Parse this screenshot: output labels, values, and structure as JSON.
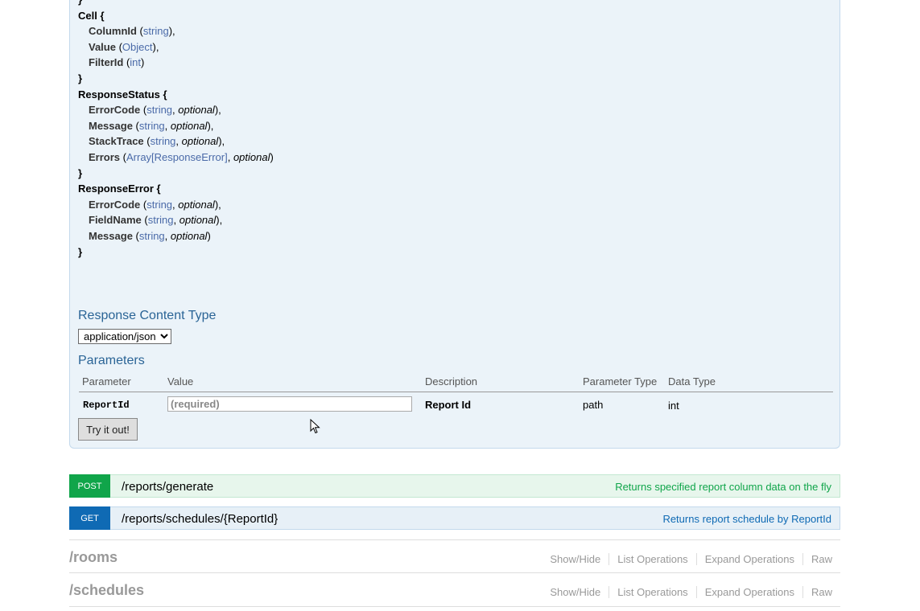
{
  "models": [
    {
      "id": "prev",
      "name": "",
      "closing_only": true,
      "props": []
    },
    {
      "id": "cell",
      "name": "Cell",
      "props": [
        {
          "name": "ColumnId",
          "type": "string",
          "optional": false,
          "trail": ","
        },
        {
          "name": "Value",
          "type": "Object",
          "optional": false,
          "trail": ","
        },
        {
          "name": "FilterId",
          "type": "int",
          "optional": false,
          "trail": ""
        }
      ]
    },
    {
      "id": "response-status",
      "name": "ResponseStatus",
      "props": [
        {
          "name": "ErrorCode",
          "type": "string",
          "optional": true,
          "trail": ","
        },
        {
          "name": "Message",
          "type": "string",
          "optional": true,
          "trail": ","
        },
        {
          "name": "StackTrace",
          "type": "string",
          "optional": true,
          "trail": ","
        },
        {
          "name": "Errors",
          "type": "Array[ResponseError]",
          "optional": true,
          "trail": ""
        }
      ]
    },
    {
      "id": "response-error",
      "name": "ResponseError",
      "props": [
        {
          "name": "ErrorCode",
          "type": "string",
          "optional": true,
          "trail": ","
        },
        {
          "name": "FieldName",
          "type": "string",
          "optional": true,
          "trail": ","
        },
        {
          "name": "Message",
          "type": "string",
          "optional": true,
          "trail": ""
        }
      ]
    }
  ],
  "optional_word": "optional",
  "response_content_type": {
    "heading": "Response Content Type",
    "selected": "application/json"
  },
  "parameters": {
    "heading": "Parameters",
    "columns": [
      "Parameter",
      "Value",
      "Description",
      "Parameter Type",
      "Data Type"
    ],
    "rows": [
      {
        "name": "ReportId",
        "placeholder": "(required)",
        "description": "Report Id",
        "param_type": "path",
        "data_type": "int"
      }
    ]
  },
  "try_button": "Try it out!",
  "operations": [
    {
      "verb": "POST",
      "path": "/reports/generate",
      "summary": "Returns specified report column data on the fly"
    },
    {
      "verb": "GET",
      "path": "/reports/schedules/{ReportId}",
      "summary": "Returns report schedule by ReportId"
    }
  ],
  "resources": [
    {
      "name": "/rooms",
      "links": [
        "Show/Hide",
        "List Operations",
        "Expand Operations",
        "Raw"
      ]
    },
    {
      "name": "/schedules",
      "links": [
        "Show/Hide",
        "List Operations",
        "Expand Operations",
        "Raw"
      ]
    }
  ],
  "colors": {
    "post": "#10a54a",
    "get": "#0f6ab4",
    "heading": "#2a6496"
  }
}
